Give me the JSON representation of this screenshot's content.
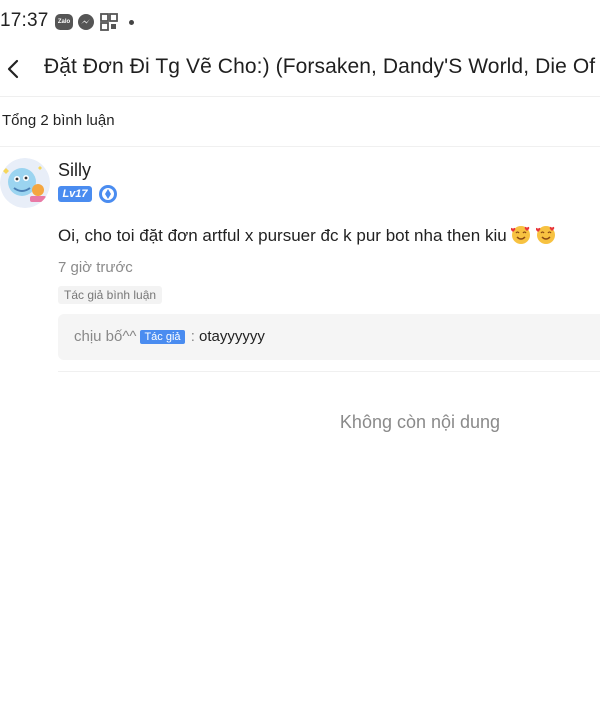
{
  "status_bar": {
    "time": "17:37",
    "zalo_label": "Zalo",
    "icons": [
      "zalo-icon",
      "messenger-icon",
      "qr-scan-icon",
      "dot-icon"
    ]
  },
  "header": {
    "back_icon": "chevron-left-icon",
    "title": "Đặt Đơn Đi Tg Vẽ Cho:) (Forsaken, Dandy'S World, Die Of Death)"
  },
  "comments_summary": {
    "label": "Tổng 2 bình luận"
  },
  "comment": {
    "username": "Silly",
    "level": "Lv17",
    "text": "Oi, cho toi đặt đơn artful x pursuer đc k pur bot nha then kiu",
    "emojis": [
      "smiling-face-with-hearts",
      "smiling-face-with-hearts"
    ],
    "timestamp": "7 giờ trước",
    "author_liked": "Tác giả bình luận",
    "reply": {
      "user": "chịu bố^^",
      "author_tag": "Tác giả",
      "separator": " : ",
      "text": "otayyyyyy"
    }
  },
  "footer": {
    "no_more": "Không còn nội dung"
  },
  "colors": {
    "accent": "#4a8cf0",
    "muted": "#8a8a8a"
  }
}
